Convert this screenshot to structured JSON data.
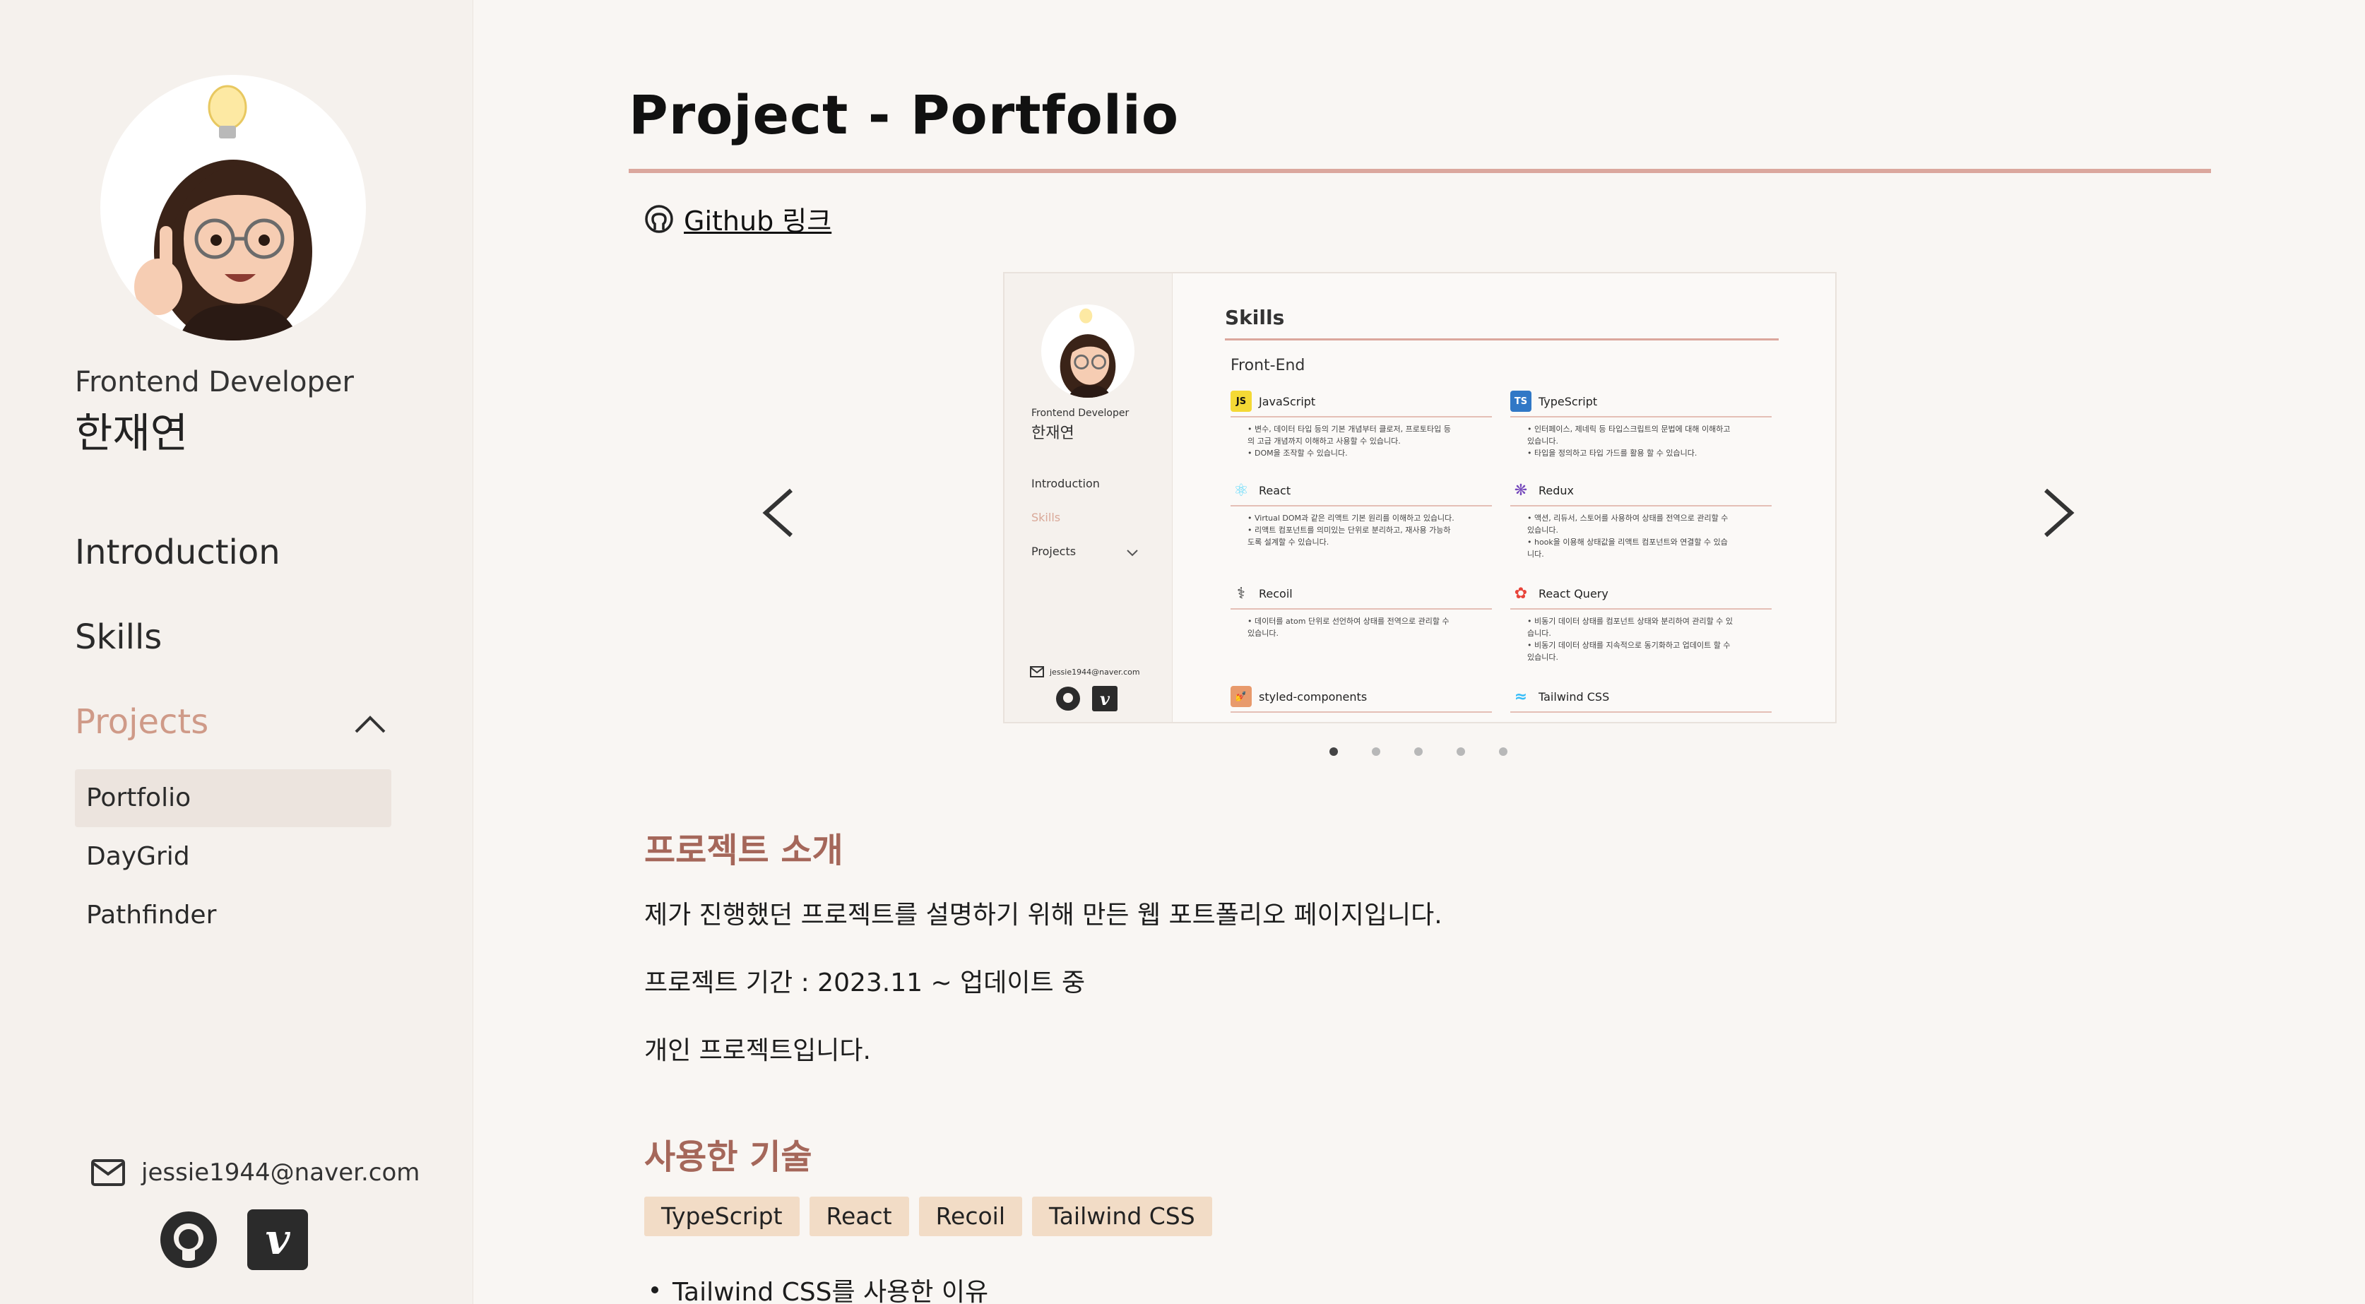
{
  "sidebar": {
    "role": "Frontend Developer",
    "name": "한재연",
    "nav": {
      "introduction": "Introduction",
      "skills": "Skills",
      "projects": "Projects"
    },
    "projects": [
      "Portfolio",
      "DayGrid",
      "Pathfinder"
    ],
    "email": "jessie1944@naver.com"
  },
  "main": {
    "title": "Project - Portfolio",
    "github_link": "Github 링크",
    "carousel": {
      "screenshot": {
        "role": "Frontend Developer",
        "name": "한재연",
        "nav": [
          "Introduction",
          "Skills",
          "Projects"
        ],
        "email": "jessie1944@naver.com",
        "heading": "Skills",
        "subheading": "Front-End",
        "skills": [
          {
            "name": "JavaScript",
            "lines": [
              "• 변수, 데이터 타입 등의 기본 개념부터 클로저, 프로토타입 등",
              "의 고급 개념까지 이해하고 사용할 수 있습니다.",
              "• DOM을 조작할 수 있습니다."
            ]
          },
          {
            "name": "TypeScript",
            "lines": [
              "• 인터페이스, 제네릭 등 타입스크립트의 문법에 대해 이해하고",
              "있습니다.",
              "• 타입을 정의하고 타입 가드를 활용 할 수 있습니다."
            ]
          },
          {
            "name": "React",
            "lines": [
              "• Virtual DOM과 같은 리액트 기본 원리를 이해하고 있습니다.",
              "• 리액트 컴포넌트를 의미있는 단위로 분리하고, 재사용 가능하",
              "도록 설계할 수 있습니다."
            ]
          },
          {
            "name": "Redux",
            "lines": [
              "• 액션, 리듀서, 스토어를 사용하여 상태를 전역으로 관리할 수",
              "있습니다.",
              "• hook을 이용해 상태값을 리액트 컴포넌트와 연결할 수 있습",
              "니다."
            ]
          },
          {
            "name": "Recoil",
            "lines": [
              "• 데이터를 atom 단위로 선언하여 상태를 전역으로 관리할 수",
              "있습니다."
            ]
          },
          {
            "name": "React Query",
            "lines": [
              "• 비동기 데이터 상태를 컴포넌트 상태와 분리하여 관리할 수 있",
              "습니다.",
              "• 비동기 데이터 상태를 지속적으로 동기화하고 업데이트 할 수",
              "있습니다."
            ]
          },
          {
            "name": "styled-components",
            "lines": []
          },
          {
            "name": "Tailwind CSS",
            "lines": []
          }
        ]
      },
      "slides": 5,
      "active": 0
    },
    "intro_heading": "프로젝트 소개",
    "paragraphs": [
      "제가 진행했던 프로젝트를 설명하기 위해 만든 웹 포트폴리오 페이지입니다.",
      "프로젝트 기간 : 2023.11 ~ 업데이트 중",
      "개인 프로젝트입니다."
    ],
    "tech_heading": "사용한 기술",
    "tags": [
      "TypeScript",
      "React",
      "Recoil",
      "Tailwind CSS"
    ],
    "bullet": "Tailwind CSS를 사용한 이유"
  }
}
